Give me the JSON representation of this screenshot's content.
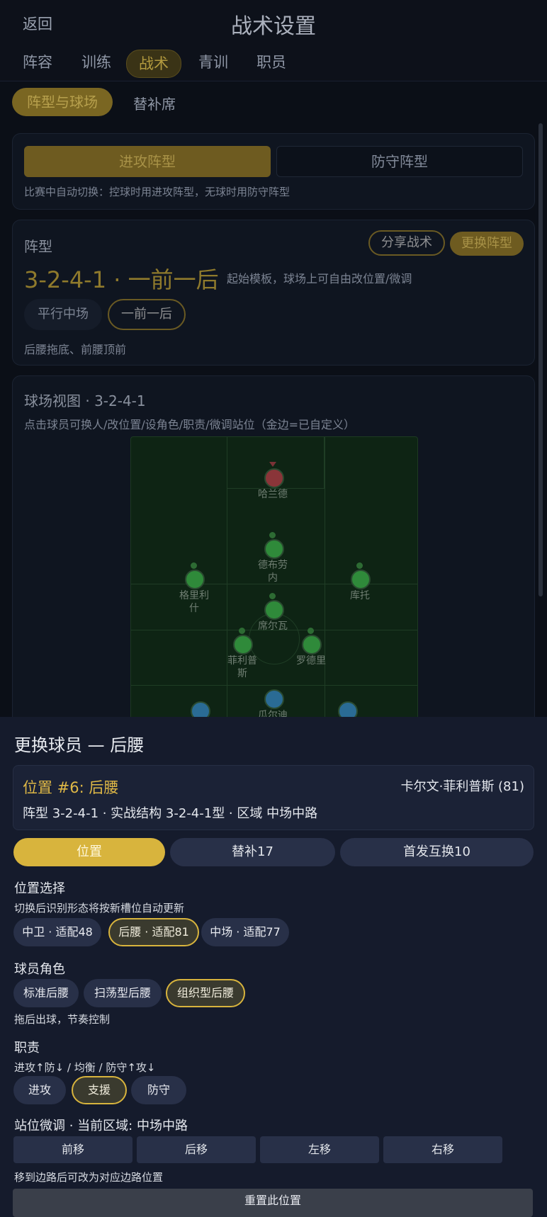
{
  "header": {
    "back": "返回",
    "title": "战术设置"
  },
  "tabs": [
    "阵容",
    "训练",
    "战术",
    "青训",
    "职员"
  ],
  "subtabs": {
    "active": "阵型与球场",
    "other": "替补席"
  },
  "mode": {
    "attack": "进攻阵型",
    "defense": "防守阵型",
    "hint": "比赛中自动切换：控球时用进攻阵型，无球时用防守阵型"
  },
  "formation": {
    "label": "阵型",
    "share": "分享战术",
    "change": "更换阵型",
    "name": "3-2-4-1 · 一前一后",
    "desc": "起始模板，球场上可自由改位置/微调",
    "variant_a": "平行中场",
    "variant_b": "一前一后",
    "note": "后腰拖底、前腰顶前"
  },
  "pitch": {
    "title": "球场视图 · 3-2-4-1",
    "hint": "点击球员可换人/改位置/设角色/职责/微调站位（金边=已自定义）",
    "players": {
      "p1": "哈兰德",
      "p2": "德布劳\n内",
      "p3": "格里利\n什",
      "p4": "库托",
      "p5": "席尔瓦",
      "p6": "菲利普\n斯",
      "p7": "罗德里",
      "p8": "瓜尔迪"
    }
  },
  "sheet": {
    "title": "更换球员 — 后腰",
    "pos_title": "位置 #6: 后腰",
    "player": "卡尔文·菲利普斯 (81)",
    "structure": "阵型 3-2-4-1 · 实战结构 3-2-4-1型 · 区域 中场中路",
    "seg_position": "位置",
    "seg_sub": "替补17",
    "seg_swap": "首发互换10",
    "pos_select": "位置选择",
    "pos_hint": "切换后识别形态将按新槽位自动更新",
    "pos_opt1": "中卫 · 适配48",
    "pos_opt2": "后腰 · 适配81",
    "pos_opt3": "中场 · 适配77",
    "role_title": "球员角色",
    "role1": "标准后腰",
    "role2": "扫荡型后腰",
    "role3": "组织型后腰",
    "role_desc": "拖后出球，节奏控制",
    "duty_title": "职责",
    "duty_hint": "进攻↑防↓ / 均衡 / 防守↑攻↓",
    "duty1": "进攻",
    "duty2": "支援",
    "duty3": "防守",
    "adjust_title": "站位微调 · 当前区域: 中场中路",
    "move1": "前移",
    "move2": "后移",
    "move3": "左移",
    "move4": "右移",
    "edge_hint": "移到边路后可改为对应边路位置",
    "reset": "重置此位置"
  }
}
